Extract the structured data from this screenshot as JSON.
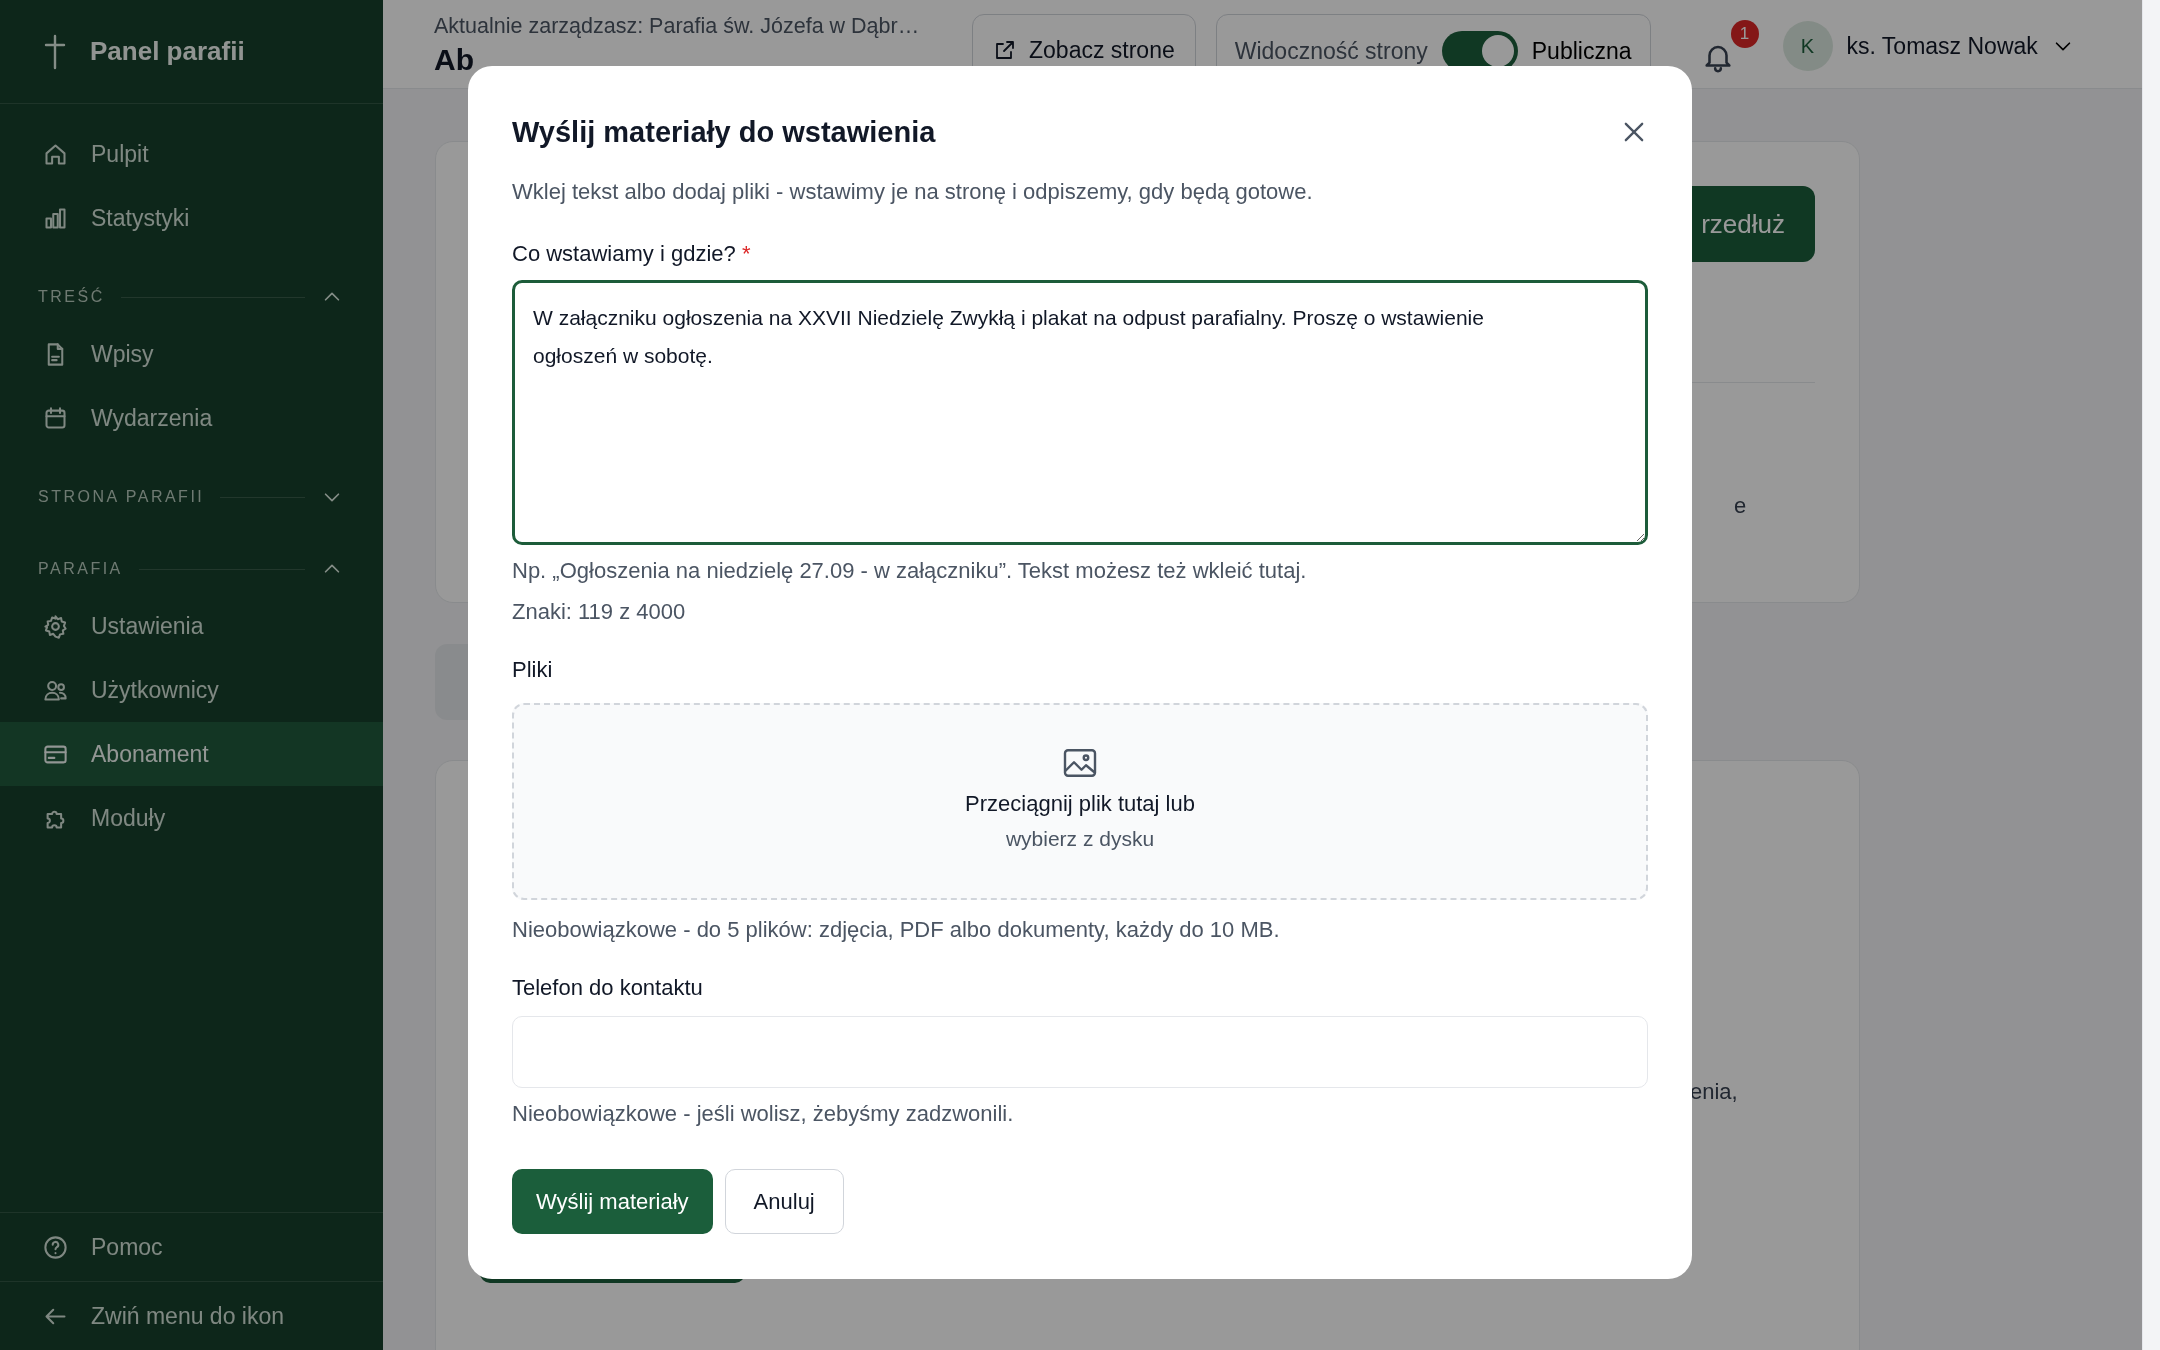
{
  "sidebar": {
    "brand": "Panel parafii",
    "items": [
      {
        "label": "Pulpit",
        "kind": "home",
        "selected": false
      },
      {
        "label": "Statystyki",
        "kind": "chart",
        "selected": false
      }
    ],
    "sections": [
      {
        "title": "TREŚĆ",
        "expanded": true,
        "items": [
          {
            "label": "Wpisy",
            "kind": "document",
            "selected": false
          },
          {
            "label": "Wydarzenia",
            "kind": "calendar",
            "selected": false
          }
        ]
      },
      {
        "title": "STRONA PARAFII",
        "expanded": false
      },
      {
        "title": "PARAFIA",
        "expanded": true,
        "items": [
          {
            "label": "Ustawienia",
            "kind": "gear",
            "selected": false
          },
          {
            "label": "Użytkownicy",
            "kind": "users",
            "selected": false
          },
          {
            "label": "Abonament",
            "kind": "card",
            "selected": true
          },
          {
            "label": "Moduły",
            "kind": "puzzle",
            "selected": false
          }
        ]
      }
    ],
    "footer": [
      {
        "label": "Pomoc",
        "kind": "help"
      },
      {
        "label": "Zwiń menu do ikon",
        "kind": "arrow"
      }
    ]
  },
  "topbar": {
    "context": "Aktualnie zarządzasz: Parafia św. Józefa w Dąbr…",
    "heading": "Ab",
    "view_site_button": "Zobacz strone",
    "visibility": {
      "label": "Widoczność strony",
      "on": true,
      "state_label": "Publiczna"
    },
    "notifications": {
      "count": "1"
    },
    "user": {
      "initial": "K",
      "name": "ks. Tomasz Nowak"
    }
  },
  "background": {
    "cards": [
      {
        "button": "rzedłuż",
        "text": "e"
      },
      {
        "text": "enia,"
      }
    ]
  },
  "modal": {
    "title": "Wyślij materiały do wstawienia",
    "description": "Wklej tekst albo dodaj pliki - wstawimy je na stronę i odpiszemy, gdy będą gotowe.",
    "message": {
      "label": "Co wstawiamy i gdzie?",
      "required_mark": "*",
      "value": "W załączniku ogłoszenia na XXVII Niedzielę Zwykłą i plakat na odpust parafialny. Proszę o wstawienie ogłoszeń w sobotę.",
      "hint": "Np. „Ogłoszenia na niedzielę 27.09 - w załączniku”. Tekst możesz też wkleić tutaj.",
      "counter": "Znaki: 119 z 4000"
    },
    "files": {
      "label": "Pliki",
      "drop_text": "Przeciągnij plik tutaj lub",
      "browse_link": "wybierz z dysku",
      "hint": "Nieobowiązkowe - do 5 plików: zdjęcia, PDF albo dokumenty, każdy do 10 MB."
    },
    "phone": {
      "label": "Telefon do kontaktu",
      "hint": "Nieobowiązkowe - jeśli wolisz, żebyśmy zadzwonili."
    },
    "buttons": [
      {
        "label": "Wyślij materiały",
        "kind": "primary"
      },
      {
        "label": "Anuluj",
        "kind": "secondary"
      }
    ]
  }
}
